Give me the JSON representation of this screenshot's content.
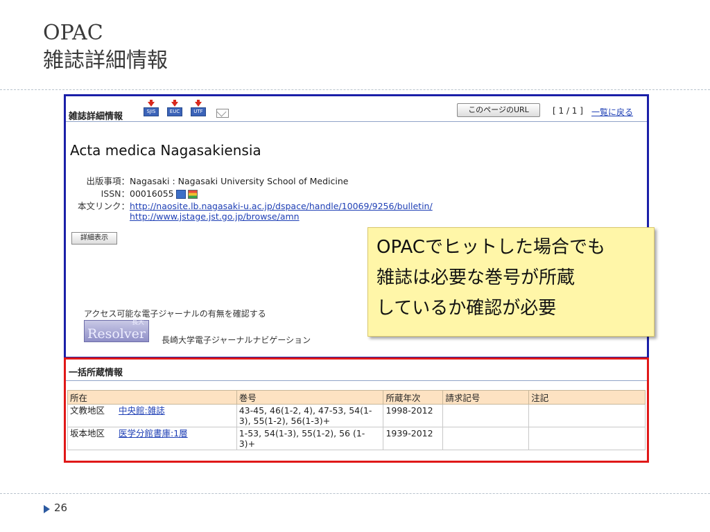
{
  "slide": {
    "title_line1": "OPAC",
    "title_line2": "雑誌詳細情報",
    "page_number": "26"
  },
  "panel": {
    "header_title": "雑誌詳細情報",
    "download_icons": [
      "SJIS",
      "EUC",
      "UTF"
    ],
    "url_button": "このページのURL",
    "page_count": "[ 1 / 1 ]",
    "back_link": "一覧に戻る",
    "journal_title": "Acta medica Nagasakiensia",
    "publication_label": "出版事項：",
    "publication_value": "Nagasaki : Nagasaki University School of Medicine",
    "issn_label": "ISSN：",
    "issn_value": "00016055",
    "link_label": "本文リンク：",
    "link1": "http://naosite.lb.nagasaki-u.ac.jp/dspace/handle/10069/9256/bulletin/",
    "link2": "http://www.jstage.jst.go.jp/browse/amn",
    "detail_button": "詳細表示",
    "access_text": "アクセス可能な電子ジャーナルの有無を確認する",
    "resolver_logo": "Resolver",
    "resolver_tag": "長大",
    "navigation_label": "長崎大学電子ジャーナルナビゲーション"
  },
  "callout": {
    "line1": "OPACでヒットした場合でも",
    "line2": "雑誌は必要な巻号が所蔵",
    "line3": "しているか確認が必要"
  },
  "holdings": {
    "title": "一括所蔵情報",
    "headers": [
      "所在",
      "巻号",
      "所蔵年次",
      "請求記号",
      "注記"
    ],
    "rows": [
      {
        "area": "文教地区",
        "location": "中央館:雑誌",
        "volumes": "43-45, 46(1-2, 4), 47-53, 54(1-3), 55(1-2), 56(1-3)+",
        "years": "1998-2012",
        "call_number": "",
        "note": ""
      },
      {
        "area": "坂本地区",
        "location": "医学分館書庫:1層",
        "volumes": "1-53, 54(1-3), 55(1-2), 56 (1-3)+",
        "years": "1939-2012",
        "call_number": "",
        "note": ""
      }
    ]
  },
  "colors": {
    "panel_border": "#1a1fa8",
    "holdings_border": "#e01818",
    "callout_bg": "#fff6a8",
    "link": "#1e3fb5",
    "table_header_bg": "#fde2c2"
  }
}
